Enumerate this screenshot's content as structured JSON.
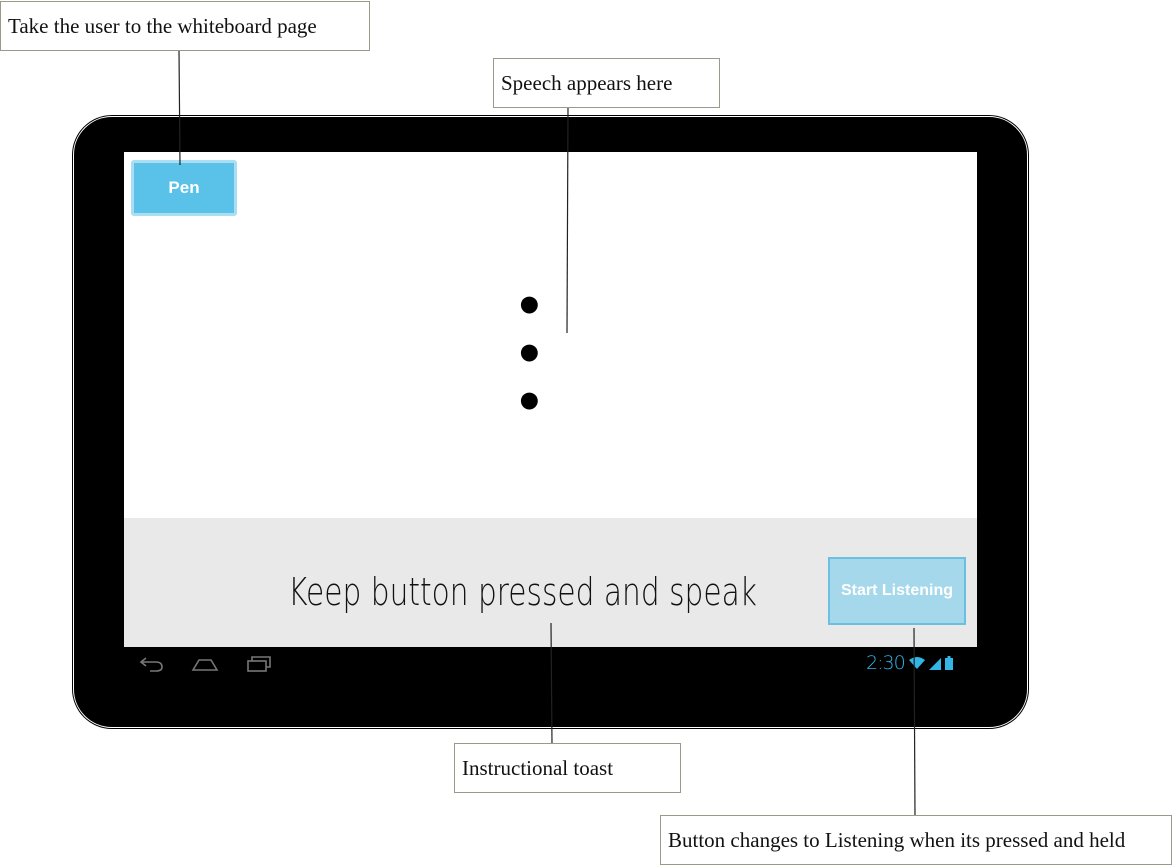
{
  "annotations": {
    "pen_note": "Take the user to the whiteboard page",
    "speech_note": "Speech appears here",
    "toast_note": "Instructional toast",
    "button_note": "Button changes to Listening when its pressed and held"
  },
  "app": {
    "pen_button": "Pen",
    "speech_text": "• • •",
    "toast_text": "Keep button pressed and speak",
    "listen_button": "Start Listening"
  },
  "navbar": {
    "icons": [
      "back-icon",
      "home-icon",
      "recent-apps-icon"
    ]
  },
  "status_bar": {
    "time": "2:30",
    "icons": [
      "wifi-icon",
      "signal-icon",
      "battery-icon"
    ],
    "accent_color": "#33b5e5"
  },
  "colors": {
    "pen_button": "#5ac1e8",
    "listen_button": "#a6d8eb",
    "toast_background": "#e9e9e9"
  }
}
